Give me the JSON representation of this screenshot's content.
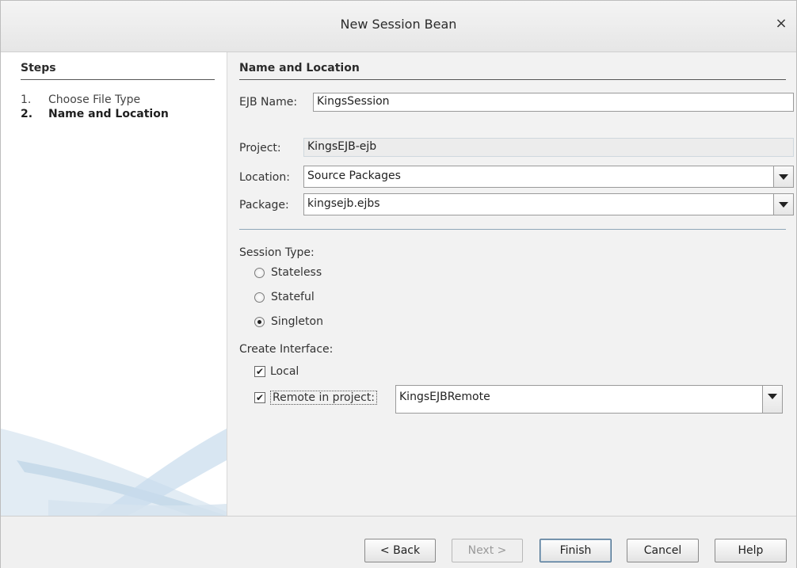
{
  "dialog": {
    "title": "New Session Bean",
    "close": "×"
  },
  "steps": {
    "title": "Steps",
    "items": [
      {
        "num": "1.",
        "label": "Choose File Type"
      },
      {
        "num": "2.",
        "label": "Name and Location"
      }
    ]
  },
  "form": {
    "section_title": "Name and Location",
    "ejb_name_label": "EJB Name:",
    "ejb_name_value": "KingsSession",
    "project_label": "Project:",
    "project_value": "KingsEJB-ejb",
    "location_label": "Location:",
    "location_value": "Source Packages",
    "package_label": "Package:",
    "package_value": "kingsejb.ejbs",
    "session_type_label": "Session Type:",
    "session_types": [
      {
        "label": "Stateless",
        "selected": false
      },
      {
        "label": "Stateful",
        "selected": false
      },
      {
        "label": "Singleton",
        "selected": true
      }
    ],
    "create_interface_label": "Create Interface:",
    "local_label": "Local",
    "local_checked": true,
    "remote_label": "Remote in project:",
    "remote_checked": true,
    "remote_project_value": "KingsEJBRemote"
  },
  "buttons": {
    "back": "< Back",
    "next": "Next >",
    "finish": "Finish",
    "cancel": "Cancel",
    "help": "Help"
  }
}
